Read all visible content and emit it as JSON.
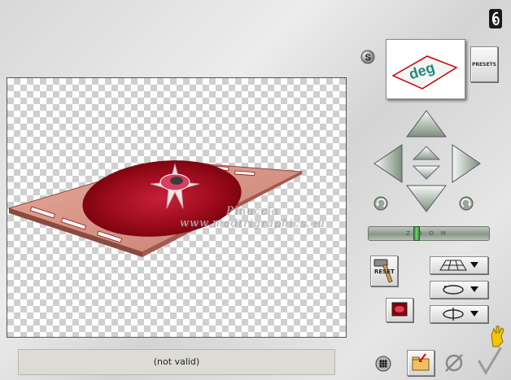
{
  "status": {
    "text": "(not valid)"
  },
  "presets": {
    "label": "PRESETS"
  },
  "thumbnail": {
    "text": "deg"
  },
  "zoom": {
    "label": "ZOOM"
  },
  "reset": {
    "label": "RESET"
  },
  "watermark": {
    "line1": "Pinuccia",
    "line2": "www.madtrigraphics.eu"
  },
  "icons": [
    "camera-icon",
    "s-badge-icon",
    "arrow-up-icon",
    "arrow-down-icon",
    "arrow-left-icon",
    "arrow-right-icon",
    "small-up-icon",
    "small-down-icon",
    "rotate-left-icon",
    "rotate-right-icon",
    "perspective-grid-icon",
    "rotate-horizontal-icon",
    "rotate-vertical-icon",
    "hammer-icon",
    "grid-icon",
    "folder-icon",
    "cancel-icon",
    "ok-icon",
    "hand-icon",
    "texture-swatch-icon"
  ],
  "colors": {
    "accent": "#8b0000",
    "canvas_check": "#cfcfcf"
  }
}
